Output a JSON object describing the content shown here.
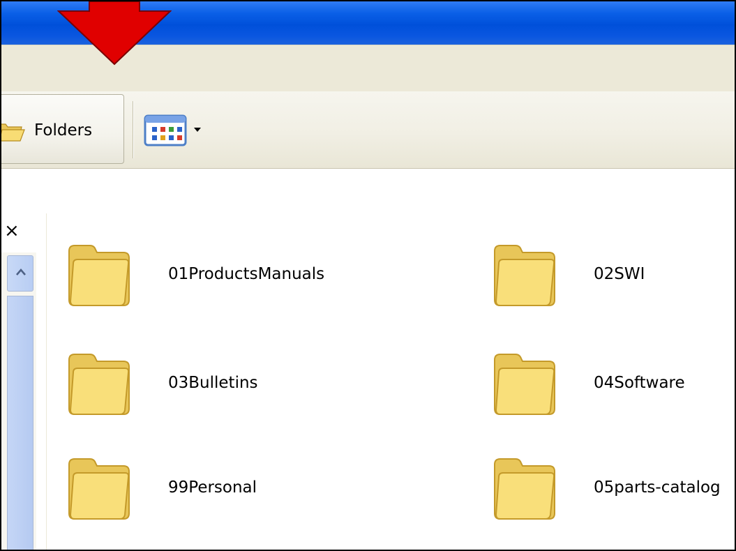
{
  "toolbar": {
    "folders_label": "Folders",
    "folders_icon": "folder-open-icon",
    "views_icon": "views-thumbnails-icon"
  },
  "navigation_pane": {
    "close_glyph": "×"
  },
  "folders": [
    {
      "name": "01ProductsManuals"
    },
    {
      "name": "02SWI"
    },
    {
      "name": "03Bulletins"
    },
    {
      "name": "04Software"
    },
    {
      "name": "99Personal"
    },
    {
      "name": "05parts-catalog"
    }
  ],
  "colors": {
    "titlebar": "#0050da",
    "annotation_arrow": "#e00000",
    "folder_fill": "#f7d766"
  }
}
